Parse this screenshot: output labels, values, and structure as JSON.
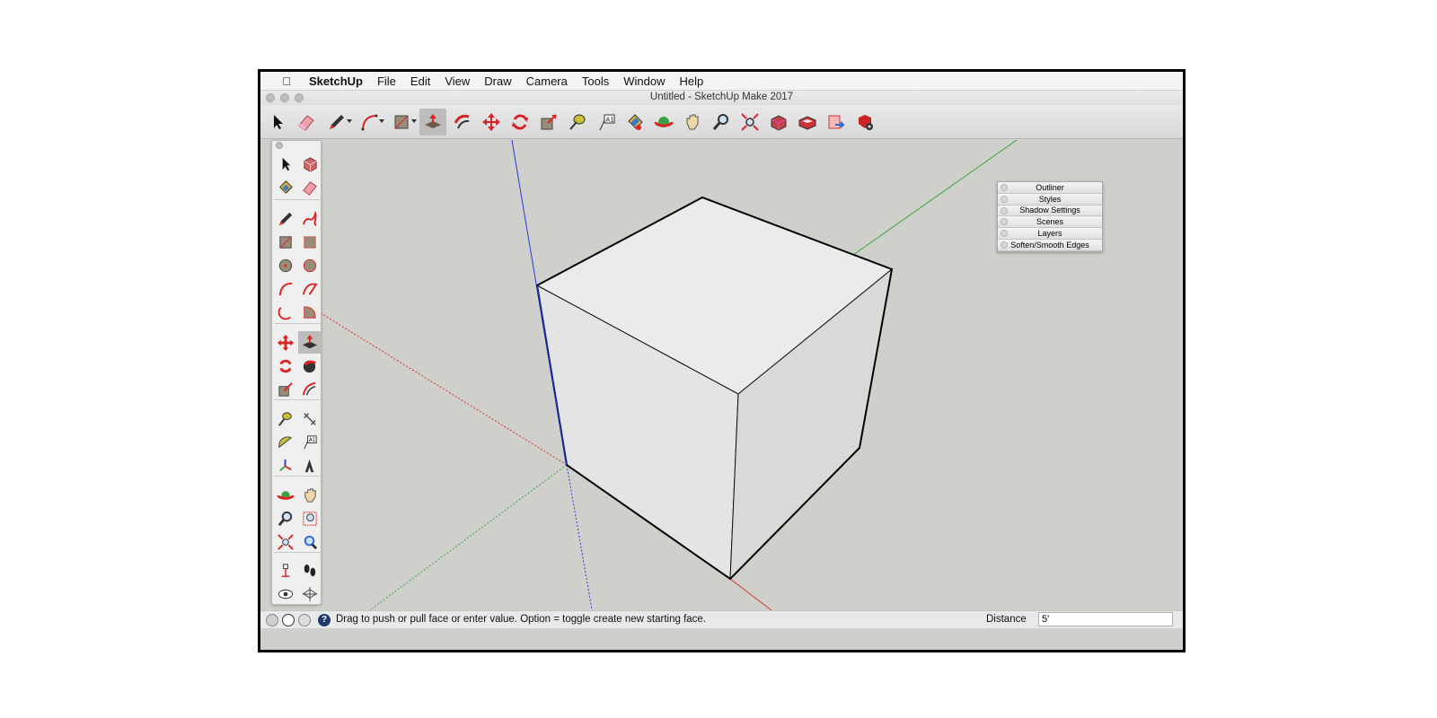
{
  "menubar": {
    "app_name": "SketchUp",
    "items": [
      "File",
      "Edit",
      "View",
      "Draw",
      "Camera",
      "Tools",
      "Window",
      "Help"
    ]
  },
  "window": {
    "title": "Untitled - SketchUp Make 2017"
  },
  "trays": [
    "Outliner",
    "Styles",
    "Shadow Settings",
    "Scenes",
    "Layers",
    "Soften/Smooth Edges"
  ],
  "status": {
    "hint": "Drag to push or pull face or enter value.  Option = toggle create new starting face.",
    "distance_label": "Distance",
    "distance_value": "5'"
  },
  "colors": {
    "axis_red": "#d23a2a",
    "axis_green": "#3aa83a",
    "axis_blue": "#2a3ad2",
    "viewport_bg": "#cfcfcc",
    "cube_top": "#ebebe9",
    "cube_left": "#e4e4e2",
    "cube_right": "#d9d9d7"
  },
  "toolbar_icons": [
    "select-icon",
    "eraser-icon",
    "pencil-icon",
    "arc-icon",
    "rectangle-icon",
    "push-pull-icon",
    "follow-me-icon",
    "move-icon",
    "rotate-icon",
    "scale-icon",
    "tape-measure-icon",
    "text-icon",
    "paint-bucket-icon",
    "orbit-icon",
    "pan-icon",
    "zoom-icon",
    "zoom-extents-icon",
    "warehouse-icon",
    "extension-warehouse-icon",
    "layout-icon",
    "extension-manager-icon"
  ]
}
